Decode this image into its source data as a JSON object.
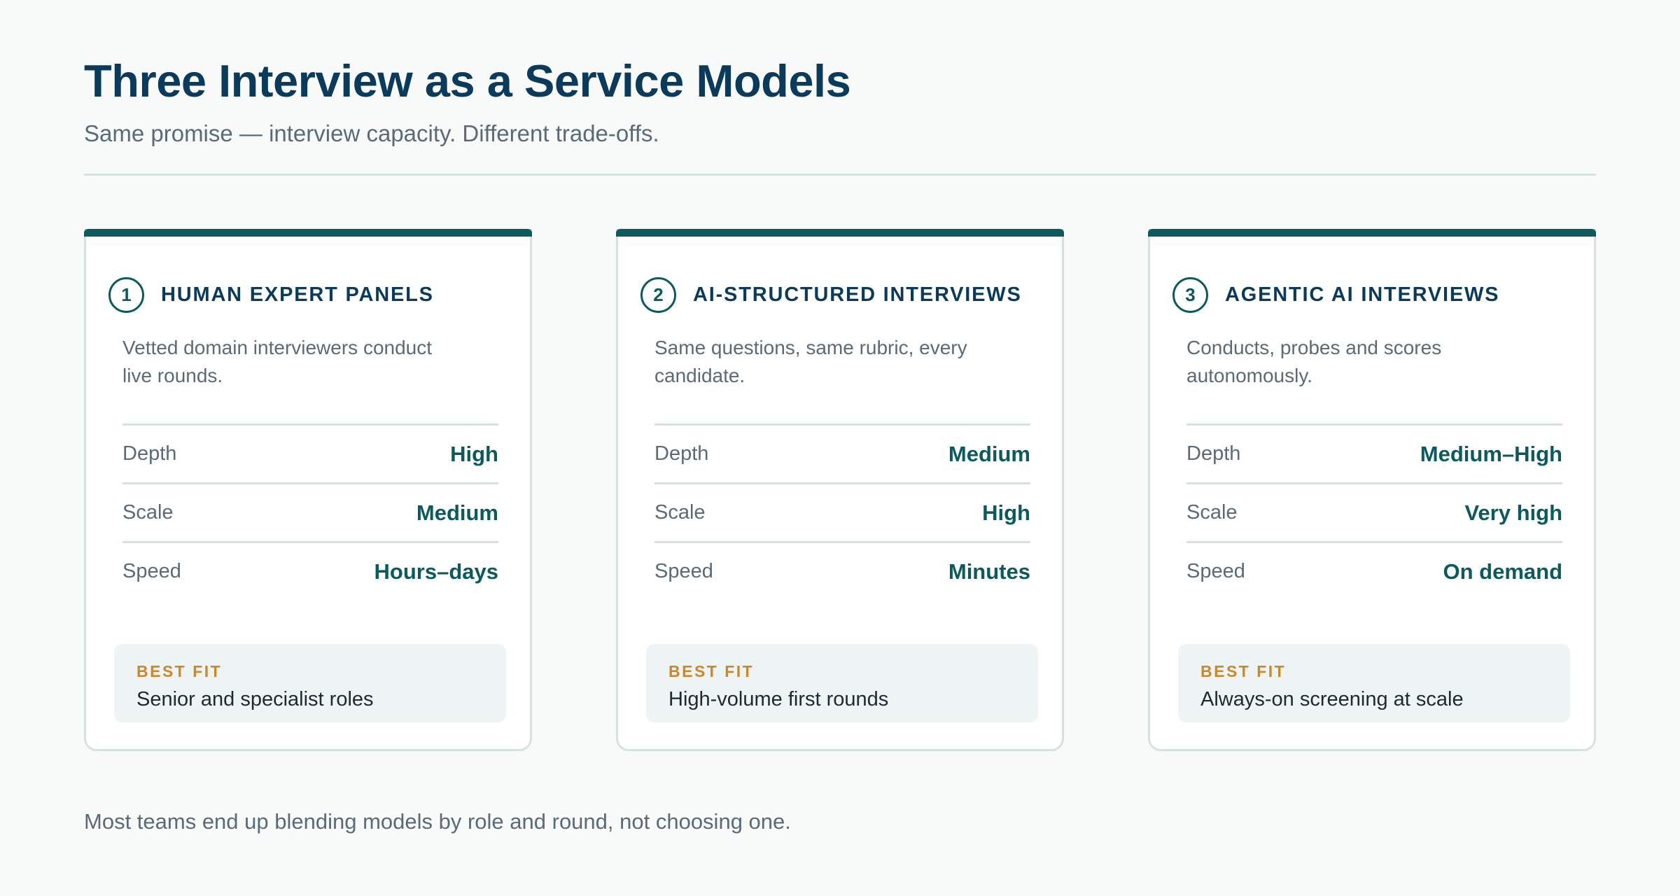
{
  "title": "Three Interview as a Service Models",
  "subtitle": "Same promise — interview capacity. Different trade-offs.",
  "cards": [
    {
      "number": "1",
      "title": "HUMAN EXPERT PANELS",
      "description": "Vetted domain interviewers conduct live rounds.",
      "metrics": [
        {
          "label": "Depth",
          "value": "High"
        },
        {
          "label": "Scale",
          "value": "Medium"
        },
        {
          "label": "Speed",
          "value": "Hours–days"
        }
      ],
      "best_fit_label": "BEST FIT",
      "best_fit": "Senior and specialist roles"
    },
    {
      "number": "2",
      "title": "AI-STRUCTURED INTERVIEWS",
      "description": "Same questions, same rubric, every candidate.",
      "metrics": [
        {
          "label": "Depth",
          "value": "Medium"
        },
        {
          "label": "Scale",
          "value": "High"
        },
        {
          "label": "Speed",
          "value": "Minutes"
        }
      ],
      "best_fit_label": "BEST FIT",
      "best_fit": "High-volume first rounds"
    },
    {
      "number": "3",
      "title": "AGENTIC AI INTERVIEWS",
      "description": "Conducts, probes and scores autonomously.",
      "metrics": [
        {
          "label": "Depth",
          "value": "Medium–High"
        },
        {
          "label": "Scale",
          "value": "Very high"
        },
        {
          "label": "Speed",
          "value": "On demand"
        }
      ],
      "best_fit_label": "BEST FIT",
      "best_fit": "Always-on screening at scale"
    }
  ],
  "footer": "Most teams end up blending models by role and round, not choosing one.",
  "colors": {
    "background": "#f8fafa",
    "title": "#0b3a5b",
    "accent": "#0c5a5e",
    "muted_text": "#5a6b77",
    "divider": "#d6e1e1",
    "best_fit_label": "#c8882e",
    "best_fit_background": "#eef4f3"
  }
}
